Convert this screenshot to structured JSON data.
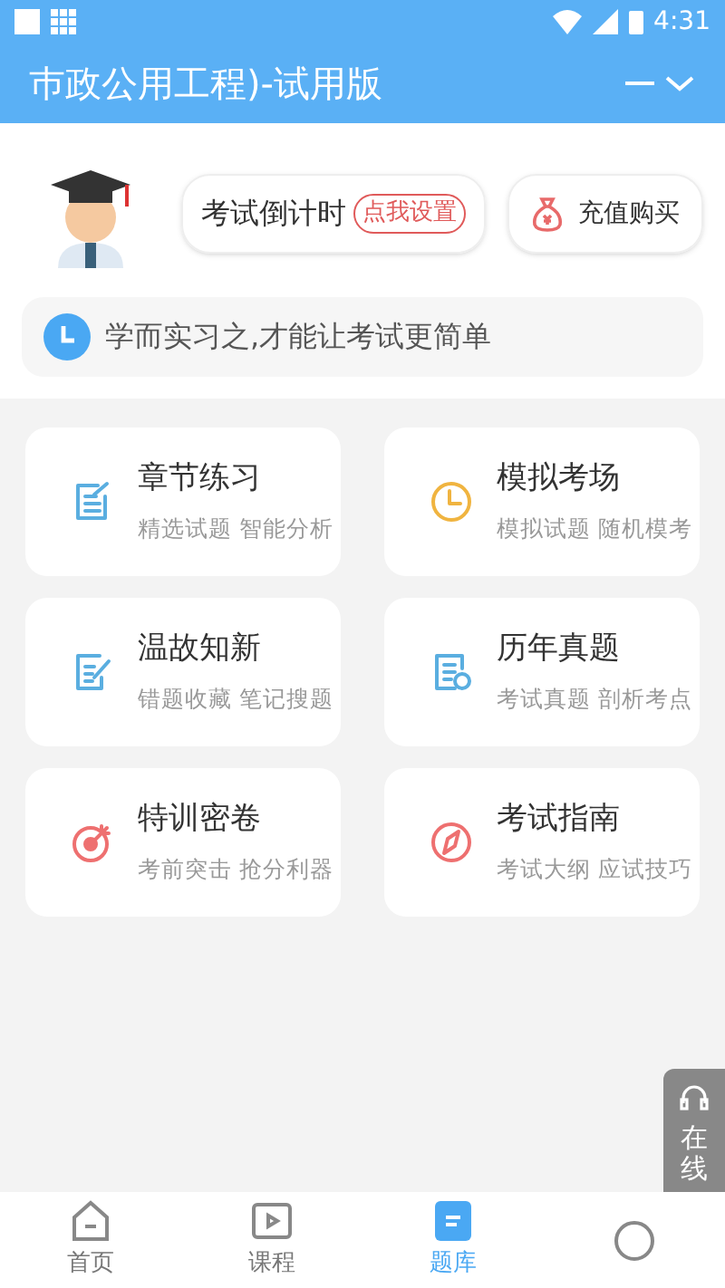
{
  "status_bar": {
    "time": "4:31"
  },
  "header": {
    "title": "巿政公用工程)-试用版"
  },
  "countdown": {
    "label": "考试倒计时",
    "action": "点我设置"
  },
  "recharge": {
    "label": "充值购买"
  },
  "motto": "学而实习之,才能让考试更简单",
  "modules": [
    {
      "kind": "chapter",
      "title": "章节练习",
      "subtitle": "精选试题 智能分析",
      "color": "#5aaee0"
    },
    {
      "kind": "mock",
      "title": "模拟考场",
      "subtitle": "模拟试题 随机模考",
      "color": "#f0b440"
    },
    {
      "kind": "review",
      "title": "温故知新",
      "subtitle": "错题收藏 笔记搜题",
      "color": "#5aaee0"
    },
    {
      "kind": "past",
      "title": "历年真题",
      "subtitle": "考试真题 剖析考点",
      "color": "#5aaee0"
    },
    {
      "kind": "target",
      "title": "特训密卷",
      "subtitle": "考前突击 抢分利器",
      "color": "#ee7070"
    },
    {
      "kind": "guide",
      "title": "考试指南",
      "subtitle": "考试大纲 应试技巧",
      "color": "#ee7070"
    }
  ],
  "side_tab": {
    "label": "在线"
  },
  "bottom_nav": [
    {
      "kind": "home",
      "label": "首页",
      "selected": false
    },
    {
      "kind": "course",
      "label": "课程",
      "selected": false
    },
    {
      "kind": "bank",
      "label": "题库",
      "selected": true
    },
    {
      "kind": "me",
      "selected": false
    }
  ]
}
